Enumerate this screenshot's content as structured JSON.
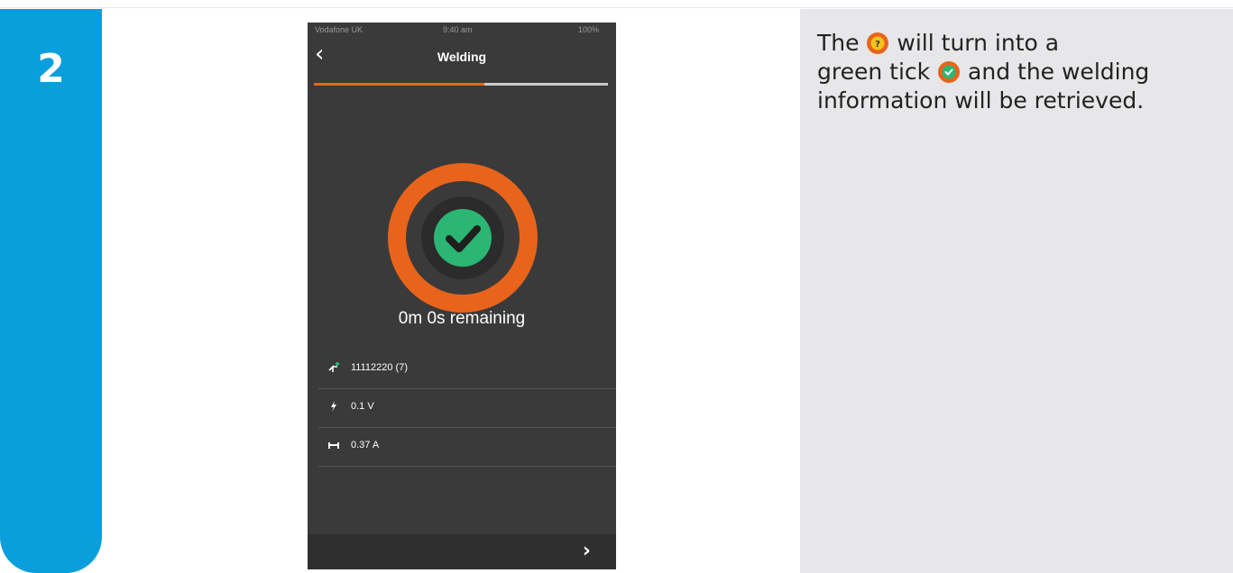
{
  "step": {
    "number": "2"
  },
  "phone": {
    "statusbar": {
      "carrier": "Vodafone UK",
      "time": "9:40 am",
      "battery": "100%"
    },
    "nav": {
      "title": "Welding",
      "back_icon": "chevron-left-icon"
    },
    "progress": {
      "fraction": 0.58,
      "fill_color": "#e8641b"
    },
    "status_icon": {
      "name": "check-circle-icon",
      "ring_color": "#e8641b",
      "tick_bg": "#2bb673"
    },
    "remaining_text": "0m 0s remaining",
    "info_rows": [
      {
        "icon": "fitting-icon",
        "value": "11112220 (7)"
      },
      {
        "icon": "voltage-icon",
        "value": "0.1 V"
      },
      {
        "icon": "current-icon",
        "value": "0.37 A"
      }
    ],
    "next_icon": "chevron-right-icon"
  },
  "instruction": {
    "part1": "The",
    "part2": "will  turn into a",
    "part3": "green tick",
    "part4": "and the welding information will be retrieved."
  }
}
